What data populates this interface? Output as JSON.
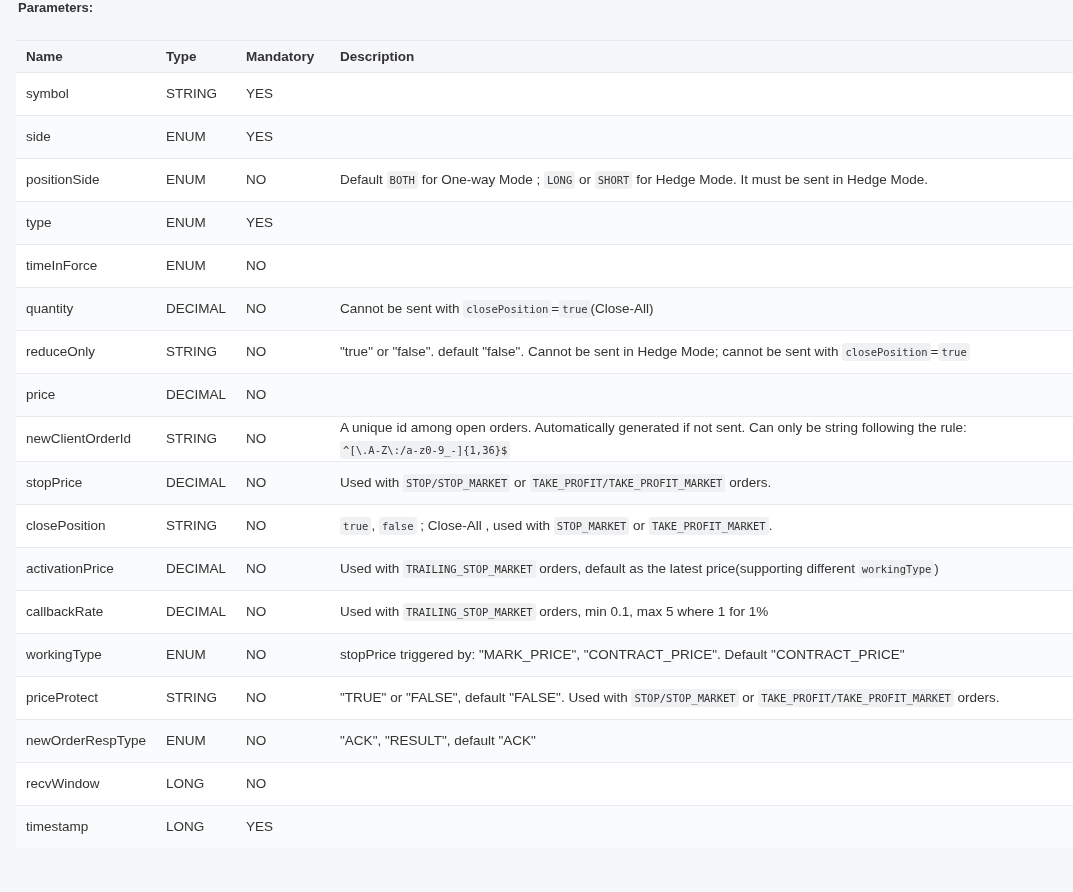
{
  "heading": "Parameters:",
  "table": {
    "columns": [
      "Name",
      "Type",
      "Mandatory",
      "Description"
    ],
    "rows": [
      {
        "name": "symbol",
        "type": "STRING",
        "mandatory": "YES",
        "description": []
      },
      {
        "name": "side",
        "type": "ENUM",
        "mandatory": "YES",
        "description": []
      },
      {
        "name": "positionSide",
        "type": "ENUM",
        "mandatory": "NO",
        "description": [
          {
            "kind": "text",
            "text": "Default "
          },
          {
            "kind": "code",
            "text": "BOTH"
          },
          {
            "kind": "text",
            "text": " for One-way Mode ; "
          },
          {
            "kind": "code",
            "text": "LONG"
          },
          {
            "kind": "text",
            "text": " or "
          },
          {
            "kind": "code",
            "text": "SHORT"
          },
          {
            "kind": "text",
            "text": " for Hedge Mode. It must be sent in Hedge Mode."
          }
        ]
      },
      {
        "name": "type",
        "type": "ENUM",
        "mandatory": "YES",
        "description": []
      },
      {
        "name": "timeInForce",
        "type": "ENUM",
        "mandatory": "NO",
        "description": []
      },
      {
        "name": "quantity",
        "type": "DECIMAL",
        "mandatory": "NO",
        "description": [
          {
            "kind": "text",
            "text": "Cannot be sent with "
          },
          {
            "kind": "code",
            "text": "closePosition"
          },
          {
            "kind": "text",
            "text": "="
          },
          {
            "kind": "code",
            "text": "true"
          },
          {
            "kind": "text",
            "text": "(Close-All)"
          }
        ]
      },
      {
        "name": "reduceOnly",
        "type": "STRING",
        "mandatory": "NO",
        "description": [
          {
            "kind": "text",
            "text": "\"true\" or \"false\". default \"false\". Cannot be sent in Hedge Mode; cannot be sent with "
          },
          {
            "kind": "code",
            "text": "closePosition"
          },
          {
            "kind": "text",
            "text": "="
          },
          {
            "kind": "code",
            "text": "true"
          }
        ]
      },
      {
        "name": "price",
        "type": "DECIMAL",
        "mandatory": "NO",
        "description": []
      },
      {
        "name": "newClientOrderId",
        "type": "STRING",
        "mandatory": "NO",
        "description": [
          {
            "kind": "text",
            "text": "A unique id among open orders. Automatically generated if not sent. Can only be string following the rule: "
          },
          {
            "kind": "code",
            "text": "^[\\.A-Z\\:/a-z0-9_-]{1,36}$"
          }
        ]
      },
      {
        "name": "stopPrice",
        "type": "DECIMAL",
        "mandatory": "NO",
        "description": [
          {
            "kind": "text",
            "text": "Used with "
          },
          {
            "kind": "code",
            "text": "STOP/STOP_MARKET"
          },
          {
            "kind": "text",
            "text": " or "
          },
          {
            "kind": "code",
            "text": "TAKE_PROFIT/TAKE_PROFIT_MARKET"
          },
          {
            "kind": "text",
            "text": " orders."
          }
        ]
      },
      {
        "name": "closePosition",
        "type": "STRING",
        "mandatory": "NO",
        "description": [
          {
            "kind": "code",
            "text": "true"
          },
          {
            "kind": "text",
            "text": ", "
          },
          {
            "kind": "code",
            "text": "false"
          },
          {
            "kind": "text",
            "text": " ; Close-All , used with "
          },
          {
            "kind": "code",
            "text": "STOP_MARKET"
          },
          {
            "kind": "text",
            "text": " or "
          },
          {
            "kind": "code",
            "text": "TAKE_PROFIT_MARKET"
          },
          {
            "kind": "text",
            "text": "."
          }
        ]
      },
      {
        "name": "activationPrice",
        "type": "DECIMAL",
        "mandatory": "NO",
        "description": [
          {
            "kind": "text",
            "text": "Used with "
          },
          {
            "kind": "code",
            "text": "TRAILING_STOP_MARKET"
          },
          {
            "kind": "text",
            "text": " orders, default as the latest price(supporting different "
          },
          {
            "kind": "code",
            "text": "workingType"
          },
          {
            "kind": "text",
            "text": ")"
          }
        ]
      },
      {
        "name": "callbackRate",
        "type": "DECIMAL",
        "mandatory": "NO",
        "description": [
          {
            "kind": "text",
            "text": "Used with "
          },
          {
            "kind": "code",
            "text": "TRAILING_STOP_MARKET"
          },
          {
            "kind": "text",
            "text": " orders, min 0.1, max 5 where 1 for 1%"
          }
        ]
      },
      {
        "name": "workingType",
        "type": "ENUM",
        "mandatory": "NO",
        "description": [
          {
            "kind": "text",
            "text": "stopPrice triggered by: \"MARK_PRICE\", \"CONTRACT_PRICE\". Default \"CONTRACT_PRICE\""
          }
        ]
      },
      {
        "name": "priceProtect",
        "type": "STRING",
        "mandatory": "NO",
        "description": [
          {
            "kind": "text",
            "text": "\"TRUE\" or \"FALSE\", default \"FALSE\". Used with "
          },
          {
            "kind": "code",
            "text": "STOP/STOP_MARKET"
          },
          {
            "kind": "text",
            "text": " or "
          },
          {
            "kind": "code",
            "text": "TAKE_PROFIT/TAKE_PROFIT_MARKET"
          },
          {
            "kind": "text",
            "text": " orders."
          }
        ]
      },
      {
        "name": "newOrderRespType",
        "type": "ENUM",
        "mandatory": "NO",
        "description": [
          {
            "kind": "text",
            "text": "\"ACK\", \"RESULT\", default \"ACK\""
          }
        ]
      },
      {
        "name": "recvWindow",
        "type": "LONG",
        "mandatory": "NO",
        "description": []
      },
      {
        "name": "timestamp",
        "type": "LONG",
        "mandatory": "YES",
        "description": []
      }
    ]
  }
}
